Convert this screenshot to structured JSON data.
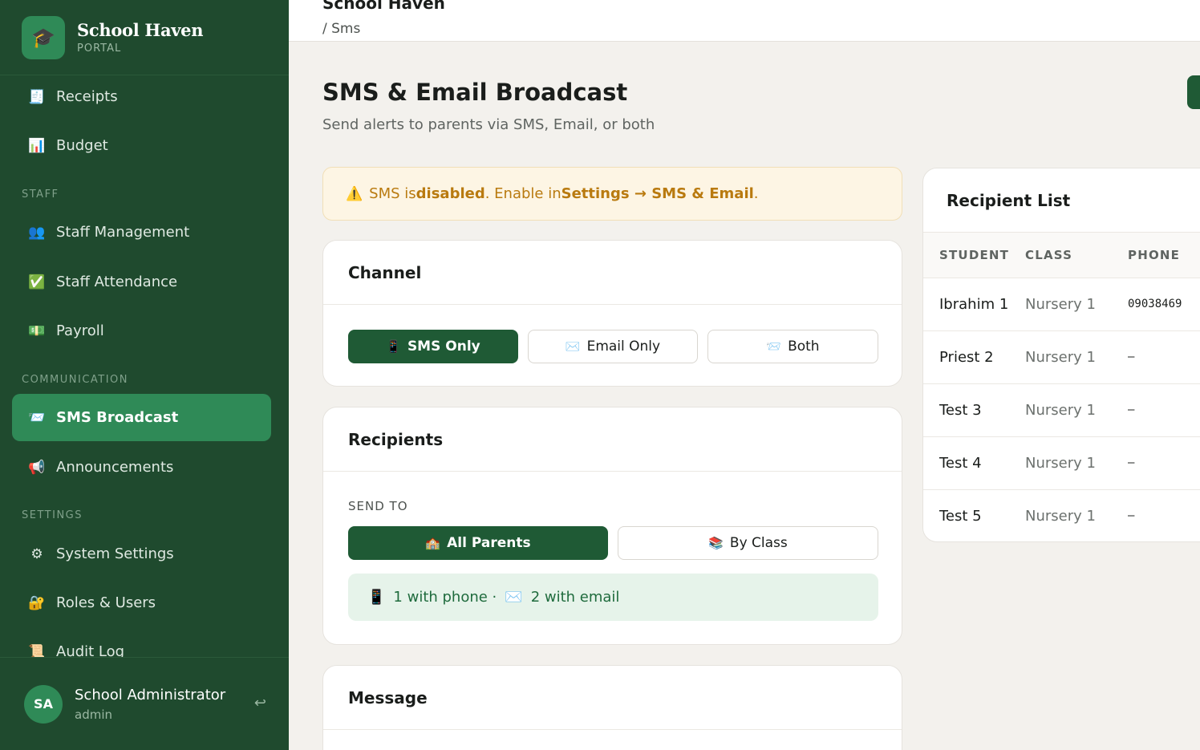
{
  "sidebar": {
    "brand_name": "School Haven",
    "brand_sub": "PORTAL",
    "brand_icon": "🎓",
    "items": {
      "receipts": {
        "icon": "🧾",
        "label": "Receipts"
      },
      "budget": {
        "icon": "📊",
        "label": "Budget"
      },
      "staff_management": {
        "icon": "👥",
        "label": "Staff Management"
      },
      "staff_attendance": {
        "icon": "✅",
        "label": "Staff Attendance"
      },
      "payroll": {
        "icon": "💵",
        "label": "Payroll"
      },
      "sms_broadcast": {
        "icon": "📨",
        "label": "SMS Broadcast"
      },
      "announcements": {
        "icon": "📢",
        "label": "Announcements"
      },
      "system_settings": {
        "icon": "⚙",
        "label": "System Settings"
      },
      "roles_users": {
        "icon": "🔐",
        "label": "Roles & Users"
      },
      "audit_log": {
        "icon": "📜",
        "label": "Audit Log"
      }
    },
    "sections": {
      "staff": "STAFF",
      "communication": "COMMUNICATION",
      "settings": "SETTINGS"
    },
    "user": {
      "initials": "SA",
      "name": "School Administrator",
      "role": "admin",
      "logout_icon": "↩"
    }
  },
  "topbar": {
    "title": "School Haven",
    "breadcrumb": "/ Sms"
  },
  "page": {
    "title": "SMS & Email Broadcast",
    "subtitle": "Send alerts to parents via SMS, Email, or both"
  },
  "alert": {
    "icon": "⚠️",
    "t1": "SMS is ",
    "t2": "disabled",
    "t3": ". Enable in ",
    "t4": "Settings → SMS & Email",
    "t5": "."
  },
  "channel": {
    "title": "Channel",
    "options": {
      "sms": {
        "icon": "📱",
        "label": "SMS Only"
      },
      "email": {
        "icon": "✉️",
        "label": "Email Only"
      },
      "both": {
        "icon": "📨",
        "label": "Both"
      }
    }
  },
  "recipients": {
    "title": "Recipients",
    "send_to": "SEND TO",
    "options": {
      "all": {
        "icon": "🏫",
        "label": "All Parents"
      },
      "class": {
        "icon": "📚",
        "label": "By Class"
      }
    },
    "stats": {
      "phone_icon": "📱",
      "phone_text": "1 with phone ·",
      "email_icon": "✉️",
      "email_text": "2 with email"
    }
  },
  "message": {
    "title": "Message"
  },
  "recipient_list": {
    "title": "Recipient List",
    "columns": [
      "STUDENT",
      "CLASS",
      "PHONE"
    ],
    "rows": [
      {
        "student": "Ibrahim 1",
        "class": "Nursery 1",
        "phone": "09038469"
      },
      {
        "student": "Priest 2",
        "class": "Nursery 1",
        "phone": "–"
      },
      {
        "student": "Test 3",
        "class": "Nursery 1",
        "phone": "–"
      },
      {
        "student": "Test 4",
        "class": "Nursery 1",
        "phone": "–"
      },
      {
        "student": "Test 5",
        "class": "Nursery 1",
        "phone": "–"
      }
    ]
  }
}
